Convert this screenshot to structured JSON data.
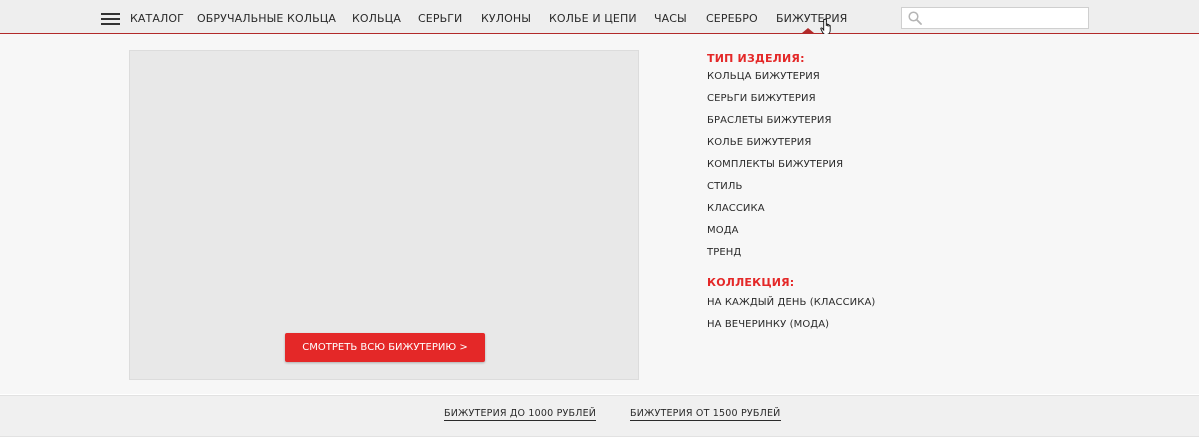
{
  "nav": {
    "menu_label": "КАТАЛОГ",
    "items": [
      {
        "label": "ОБРУЧАЛЬНЫЕ КОЛЬЦА"
      },
      {
        "label": "КОЛЬЦА"
      },
      {
        "label": "СЕРЬГИ"
      },
      {
        "label": "КУЛОНЫ"
      },
      {
        "label": "КОЛЬЕ И ЦЕПИ"
      },
      {
        "label": "ЧАСЫ"
      },
      {
        "label": "СЕРЕБРО"
      },
      {
        "label": "БИЖУТЕРИЯ"
      }
    ],
    "active_item": "БИЖУТЕРИЯ"
  },
  "search": {
    "value": "",
    "placeholder": ""
  },
  "dropdown": {
    "promo_button": "СМОТРЕТЬ ВСЮ БИЖУТЕРИЮ  >",
    "type_section": {
      "title": "ТИП ИЗДЕЛИЯ:",
      "links": [
        "КОЛЬЦА БИЖУТЕРИЯ",
        "СЕРЬГИ БИЖУТЕРИЯ",
        "БРАСЛЕТЫ БИЖУТЕРИЯ",
        "КОЛЬЕ БИЖУТЕРИЯ",
        "КОМПЛЕКТЫ БИЖУТЕРИЯ",
        "СТИЛЬ",
        "КЛАССИКА",
        "МОДА",
        "ТРЕНД"
      ]
    },
    "collection_section": {
      "title": "КОЛЛЕКЦИЯ:",
      "links": [
        "НА КАЖДЫЙ ДЕНЬ (КЛАССИКА)",
        "НА ВЕЧЕРИНКУ (МОДА)"
      ]
    }
  },
  "bottom": {
    "links": [
      "БИЖУТЕРИЯ  ДО 1000 РУБЛЕЙ",
      "БИЖУТЕРИЯ  ОТ 1500 РУБЛЕЙ"
    ]
  },
  "colors": {
    "accent": "#e42828",
    "nav_border": "#b22a2a"
  },
  "icons": [
    "menu-icon",
    "search-icon",
    "hand-cursor-icon"
  ]
}
